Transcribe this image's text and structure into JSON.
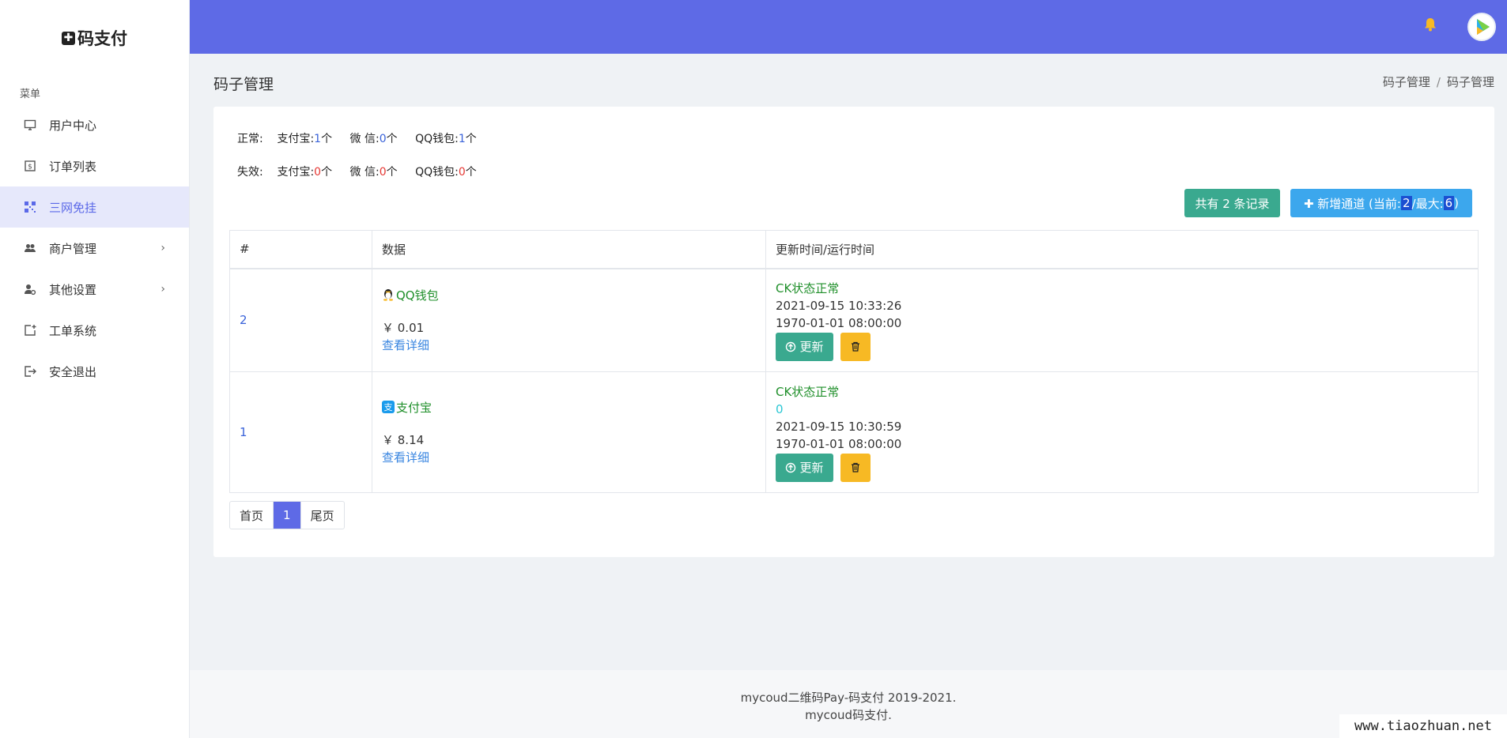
{
  "brand": {
    "name": "码支付",
    "icon": "plus-square-icon"
  },
  "sidebar": {
    "menu_title": "菜单",
    "items": [
      {
        "label": "用户中心",
        "icon": "monitor-icon"
      },
      {
        "label": "订单列表",
        "icon": "dollar-doc-icon"
      },
      {
        "label": "三网免挂",
        "icon": "qrcode-icon",
        "active": true
      },
      {
        "label": "商户管理",
        "icon": "users-icon",
        "chevron": true
      },
      {
        "label": "其他设置",
        "icon": "user-gear-icon",
        "chevron": true
      },
      {
        "label": "工单系统",
        "icon": "add-doc-icon"
      },
      {
        "label": "安全退出",
        "icon": "logout-icon"
      }
    ]
  },
  "header": {
    "page_title": "码子管理",
    "breadcrumb": [
      "码子管理",
      "码子管理"
    ]
  },
  "stats": {
    "normal": {
      "label": "正常:",
      "alipay_label": "支付宝:",
      "alipay": "1",
      "wechat_label": "微 信:",
      "wechat": "0",
      "qq_label": "QQ钱包:",
      "qq": "1",
      "unit": "个"
    },
    "invalid": {
      "label": "失效:",
      "alipay_label": "支付宝:",
      "alipay": "0",
      "wechat_label": "微 信:",
      "wechat": "0",
      "qq_label": "QQ钱包:",
      "qq": "0",
      "unit": "个"
    }
  },
  "toolbar": {
    "records": "共有 2 条记录",
    "add_prefix": "✚ 新增通道 (当前:",
    "current": "2",
    "max_label": "/最大:",
    "max": "6",
    "add_suffix": ")"
  },
  "table": {
    "headers": [
      "#",
      "数据",
      "更新时间/运行时间"
    ],
    "rows": [
      {
        "id": "2",
        "wallet": "QQ钱包",
        "wallet_icon": "qq-penguin-icon",
        "amount": "￥ 0.01",
        "detail": "查看详细",
        "status": "CK状态正常",
        "extra": "",
        "updated": "2021-09-15 10:33:26",
        "runtime": "1970-01-01 08:00:00",
        "update_label": "更新"
      },
      {
        "id": "1",
        "wallet": "支付宝",
        "wallet_icon": "alipay-icon",
        "amount": "￥ 8.14",
        "detail": "查看详细",
        "status": "CK状态正常",
        "extra": "0",
        "updated": "2021-09-15 10:30:59",
        "runtime": "1970-01-01 08:00:00",
        "update_label": "更新"
      }
    ]
  },
  "pager": {
    "first": "首页",
    "current": "1",
    "last": "尾页"
  },
  "footer": {
    "line1": "mycoud二维码Pay-码支付 2019-2021.",
    "line2": "mycoud码支付."
  },
  "watermark": "www.tiaozhuan.net",
  "colors": {
    "primary": "#5e6ae6",
    "green": "#3aa98f",
    "blue": "#3ca7ed",
    "yellow": "#f7b924"
  }
}
